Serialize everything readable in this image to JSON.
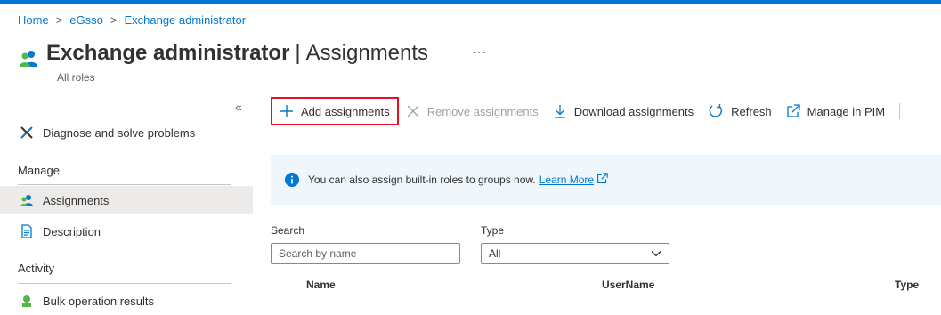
{
  "breadcrumb": {
    "items": [
      "Home",
      "eGsso",
      "Exchange administrator"
    ],
    "separator": ">"
  },
  "page": {
    "title_bold": "Exchange administrator",
    "title_rest": "Assignments",
    "subtitle": "All roles",
    "more": "···"
  },
  "sidebar": {
    "collapse": "«",
    "diagnose": "Diagnose and solve problems",
    "manage_header": "Manage",
    "assignments": "Assignments",
    "description": "Description",
    "activity_header": "Activity",
    "bulk": "Bulk operation results"
  },
  "toolbar": {
    "add": "Add assignments",
    "remove": "Remove assignments",
    "download": "Download assignments",
    "refresh": "Refresh",
    "manage_pim": "Manage in PIM"
  },
  "banner": {
    "text": "You can also assign built-in roles to groups now.",
    "link": "Learn More"
  },
  "filters": {
    "search_label": "Search",
    "search_placeholder": "Search by name",
    "type_label": "Type",
    "type_value": "All"
  },
  "table": {
    "columns": [
      "Name",
      "UserName",
      "Type"
    ]
  },
  "colors": {
    "accent": "#0078d4",
    "highlight": "#e81123",
    "banner_bg": "#eff6fc"
  }
}
